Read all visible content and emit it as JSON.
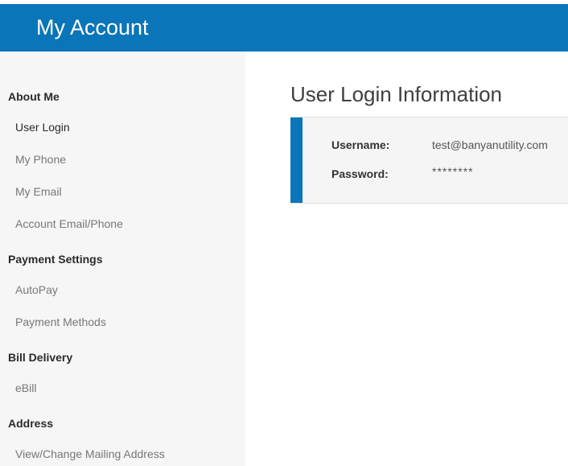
{
  "header": {
    "title": "My Account"
  },
  "sidebar": {
    "items": [
      {
        "label": "About Me",
        "type": "section"
      },
      {
        "label": "User Login",
        "type": "link",
        "active": true
      },
      {
        "label": "My Phone",
        "type": "link"
      },
      {
        "label": "My Email",
        "type": "link"
      },
      {
        "label": "Account Email/Phone",
        "type": "link"
      },
      {
        "label": "Payment Settings",
        "type": "section"
      },
      {
        "label": "AutoPay",
        "type": "link"
      },
      {
        "label": "Payment Methods",
        "type": "link"
      },
      {
        "label": "Bill Delivery",
        "type": "section"
      },
      {
        "label": "eBill",
        "type": "link"
      },
      {
        "label": "Address",
        "type": "section"
      },
      {
        "label": "View/Change Mailing Address",
        "type": "link"
      }
    ]
  },
  "main": {
    "title": "User Login Information",
    "fields": {
      "username_label": "Username:",
      "username_value": "test@banyanutility.com",
      "password_label": "Password:",
      "password_value": "********"
    }
  },
  "colors": {
    "brand": "#0a75b8",
    "sidebar_bg": "#f6f6f6",
    "card_bg": "#f5f5f5"
  }
}
